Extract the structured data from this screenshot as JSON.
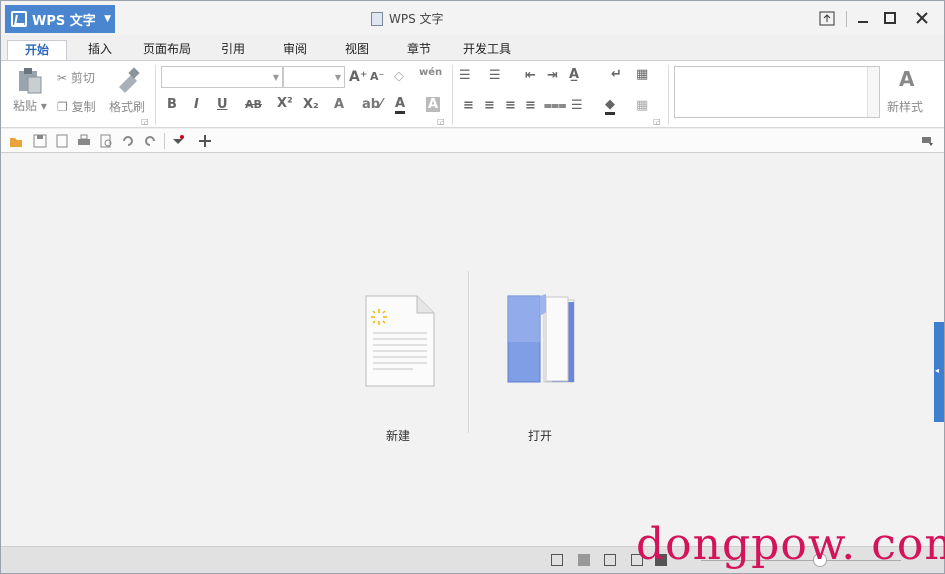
{
  "titlebar": {
    "app_button_label": "WPS 文字",
    "window_title": "WPS 文字"
  },
  "tabs": [
    {
      "label": "开始",
      "active": true
    },
    {
      "label": "插入",
      "active": false
    },
    {
      "label": "页面布局",
      "active": false
    },
    {
      "label": "引用",
      "active": false
    },
    {
      "label": "审阅",
      "active": false
    },
    {
      "label": "视图",
      "active": false
    },
    {
      "label": "章节",
      "active": false
    },
    {
      "label": "开发工具",
      "active": false
    }
  ],
  "ribbon": {
    "paste_label": "粘贴",
    "cut_label": "剪切",
    "copy_label": "复制",
    "format_painter_label": "格式刷",
    "font_name_value": "",
    "font_size_value": "",
    "new_style_label": "新样式"
  },
  "main": {
    "new_label": "新建",
    "open_label": "打开"
  },
  "watermark": {
    "text": "dongpow. com"
  },
  "colors": {
    "accent": "#4a86cf",
    "active_tab_text": "#2e6bbd",
    "side_tab": "#3e7fd0",
    "watermark": "#d4145a"
  }
}
